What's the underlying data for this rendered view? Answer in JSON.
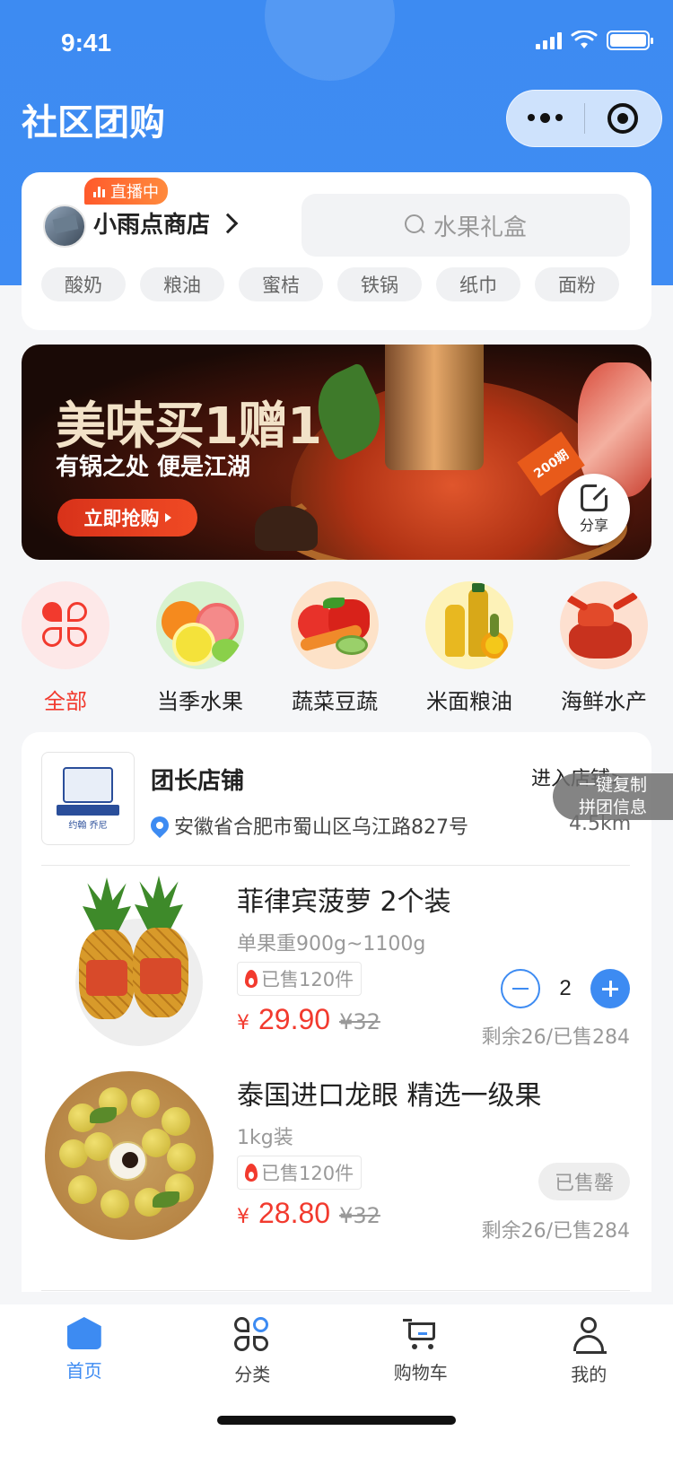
{
  "status_bar": {
    "time": "9:41"
  },
  "header": {
    "title": "社区团购"
  },
  "store": {
    "live_badge": "直播中",
    "name": "小雨点商店",
    "search_placeholder": "水果礼盒",
    "tags": [
      "酸奶",
      "粮油",
      "蜜桔",
      "铁锅",
      "纸巾",
      "面粉"
    ]
  },
  "banner": {
    "title": "美味买1赠1",
    "subtitle": "有锅之处 便是江湖",
    "button": "立即抢购",
    "tag": "200期",
    "share_label": "分享"
  },
  "categories": [
    {
      "label": "全部",
      "icon": "grid-icon",
      "active": true
    },
    {
      "label": "当季水果",
      "icon": "fruit-icon"
    },
    {
      "label": "蔬菜豆蔬",
      "icon": "vegetable-icon"
    },
    {
      "label": "米面粮油",
      "icon": "oil-icon"
    },
    {
      "label": "海鲜水产",
      "icon": "seafood-icon"
    }
  ],
  "shop": {
    "title": "团长店铺",
    "enter": "进入店铺>",
    "address": "安徽省合肥市蜀山区乌江路827号",
    "distance": "4.5km",
    "logo_text": "约翰 乔尼",
    "copy_hint_1": "一键复制",
    "copy_hint_2": "拼团信息"
  },
  "products": [
    {
      "name": "菲律宾菠萝 2个装",
      "spec": "单果重900g~1100g",
      "sold": "已售120件",
      "currency": "¥",
      "price": "29.90",
      "original": "¥32",
      "stock": "剩余26/已售284",
      "qty": "2"
    },
    {
      "name": "泰国进口龙眼 精选一级果",
      "spec": "1kg装",
      "sold": "已售120件",
      "currency": "¥",
      "price": "28.80",
      "original": "¥32",
      "stock": "剩余26/已售284",
      "status": "已售罄"
    }
  ],
  "tabbar": [
    {
      "label": "首页",
      "icon": "home-icon",
      "active": true
    },
    {
      "label": "分类",
      "icon": "category-icon"
    },
    {
      "label": "购物车",
      "icon": "cart-icon"
    },
    {
      "label": "我的",
      "icon": "user-icon"
    }
  ],
  "colors": {
    "primary": "#3d8bf2",
    "price": "#f23a2e",
    "background": "#f5f6f8"
  }
}
